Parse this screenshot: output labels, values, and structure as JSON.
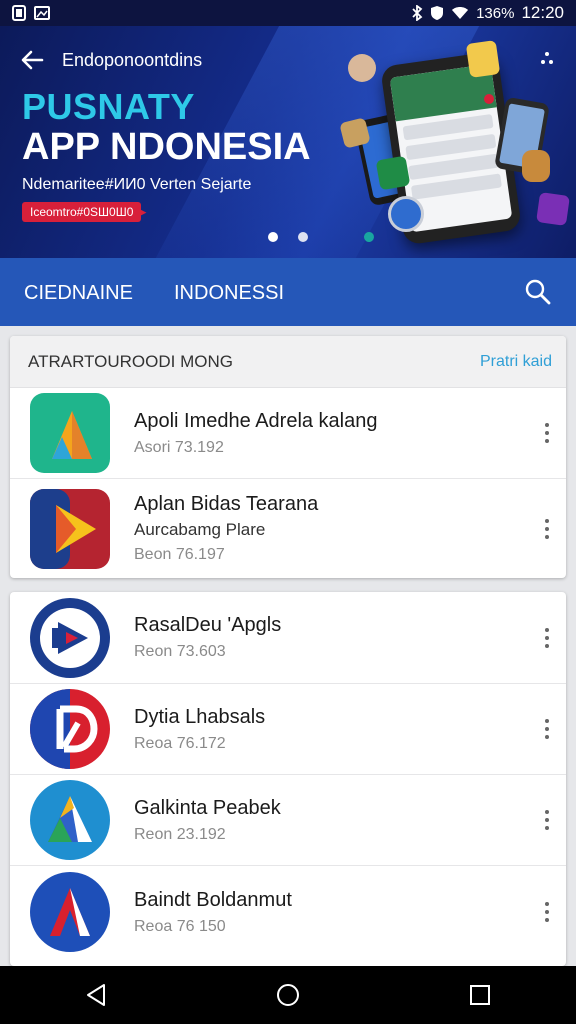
{
  "status": {
    "battery": "136%",
    "time": "12:20"
  },
  "hero": {
    "header": "Endoponoontdins",
    "title_line1": "PUSNATY",
    "title_line2": "APP NDONESIA",
    "subtitle": "Ndemaritee#ИИ0 Verten Sejarte",
    "badge": "Iceomtro#0SШ0Ш0"
  },
  "categories": {
    "items": [
      {
        "label": "CIEDNAINE"
      },
      {
        "label": "INDONESSI"
      }
    ]
  },
  "section1": {
    "title": "ATRARTOUROODI MONG",
    "link": "Pratri kaid",
    "apps": [
      {
        "name": "Apoli Imedhe Adrela kalang",
        "sub": "",
        "meta": "Asori 73.192"
      },
      {
        "name": "Aplan Bidas Tearana",
        "sub": "Aurcabamg Plare",
        "meta": "Beon 76.197"
      }
    ]
  },
  "section2": {
    "apps": [
      {
        "name": "RasalDeu 'Apgls",
        "meta": "Reon 73.603"
      },
      {
        "name": "Dytia Lhabsals",
        "meta": "Reoa 76.172"
      },
      {
        "name": "Galkinta Peabek",
        "meta": "Reon 23.192"
      },
      {
        "name": "Baindt Boldanmut",
        "meta": "Reoa 76 150"
      }
    ]
  },
  "colors": {
    "hero_bg": "#142c8c",
    "hero_accent": "#2ec9e8",
    "category_bar": "#2557b8",
    "badge": "#d8203a",
    "link": "#2f9fd6"
  },
  "icons": {
    "back": "arrow-left-icon",
    "search": "search-icon",
    "more": "more-vertical-icon",
    "nav_back": "triangle-back-icon",
    "nav_home": "circle-home-icon",
    "nav_recents": "square-recents-icon"
  }
}
